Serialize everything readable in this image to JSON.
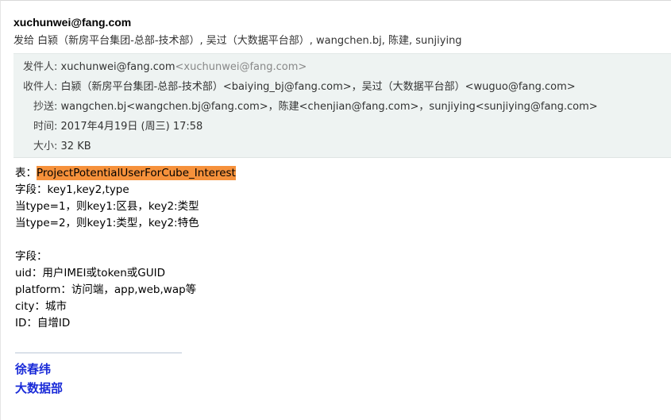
{
  "header": {
    "sender": "xuchunwei@fang.com",
    "recipients_line": "发给 白颍（新房平台集团-总部-技术部）, 吴过（大数据平台部）, wangchen.bj, 陈建, sunjiying"
  },
  "details": {
    "from_label": "发件人:",
    "from_name": "xuchunwei@fang.com",
    "from_addr": "<xuchunwei@fang.com>",
    "to_label": "收件人:",
    "to_value": "白颍（新房平台集团-总部-技术部）<baiying_bj@fang.com>，吴过（大数据平台部）<wuguo@fang.com>",
    "cc_label": "抄送:",
    "cc_value": "wangchen.bj<wangchen.bj@fang.com>，陈建<chenjian@fang.com>，sunjiying<sunjiying@fang.com>",
    "time_label": "时间:",
    "time_value": "2017年4月19日 (周三) 17:58",
    "size_label": "大小:",
    "size_value": "32 KB"
  },
  "body": {
    "table_prefix": "表：",
    "table_name": "ProjectPotentialUserForCube_Interest",
    "line2": "字段：key1,key2,type",
    "line3": "当type=1，则key1:区县，key2:类型",
    "line4": "当type=2，则key1:类型，key2:特色",
    "line5": "字段：",
    "line6": "uid：用户IMEI或token或GUID",
    "line7": "platform：访问端，app,web,wap等",
    "line8": "city：城市",
    "line9": "ID：自增ID"
  },
  "signature": {
    "name": "徐春纬",
    "dept": "大数据部"
  },
  "colors": {
    "highlight": "#f6913b",
    "signature": "#1a2bd8",
    "detail_bg": "#eef3f2"
  }
}
